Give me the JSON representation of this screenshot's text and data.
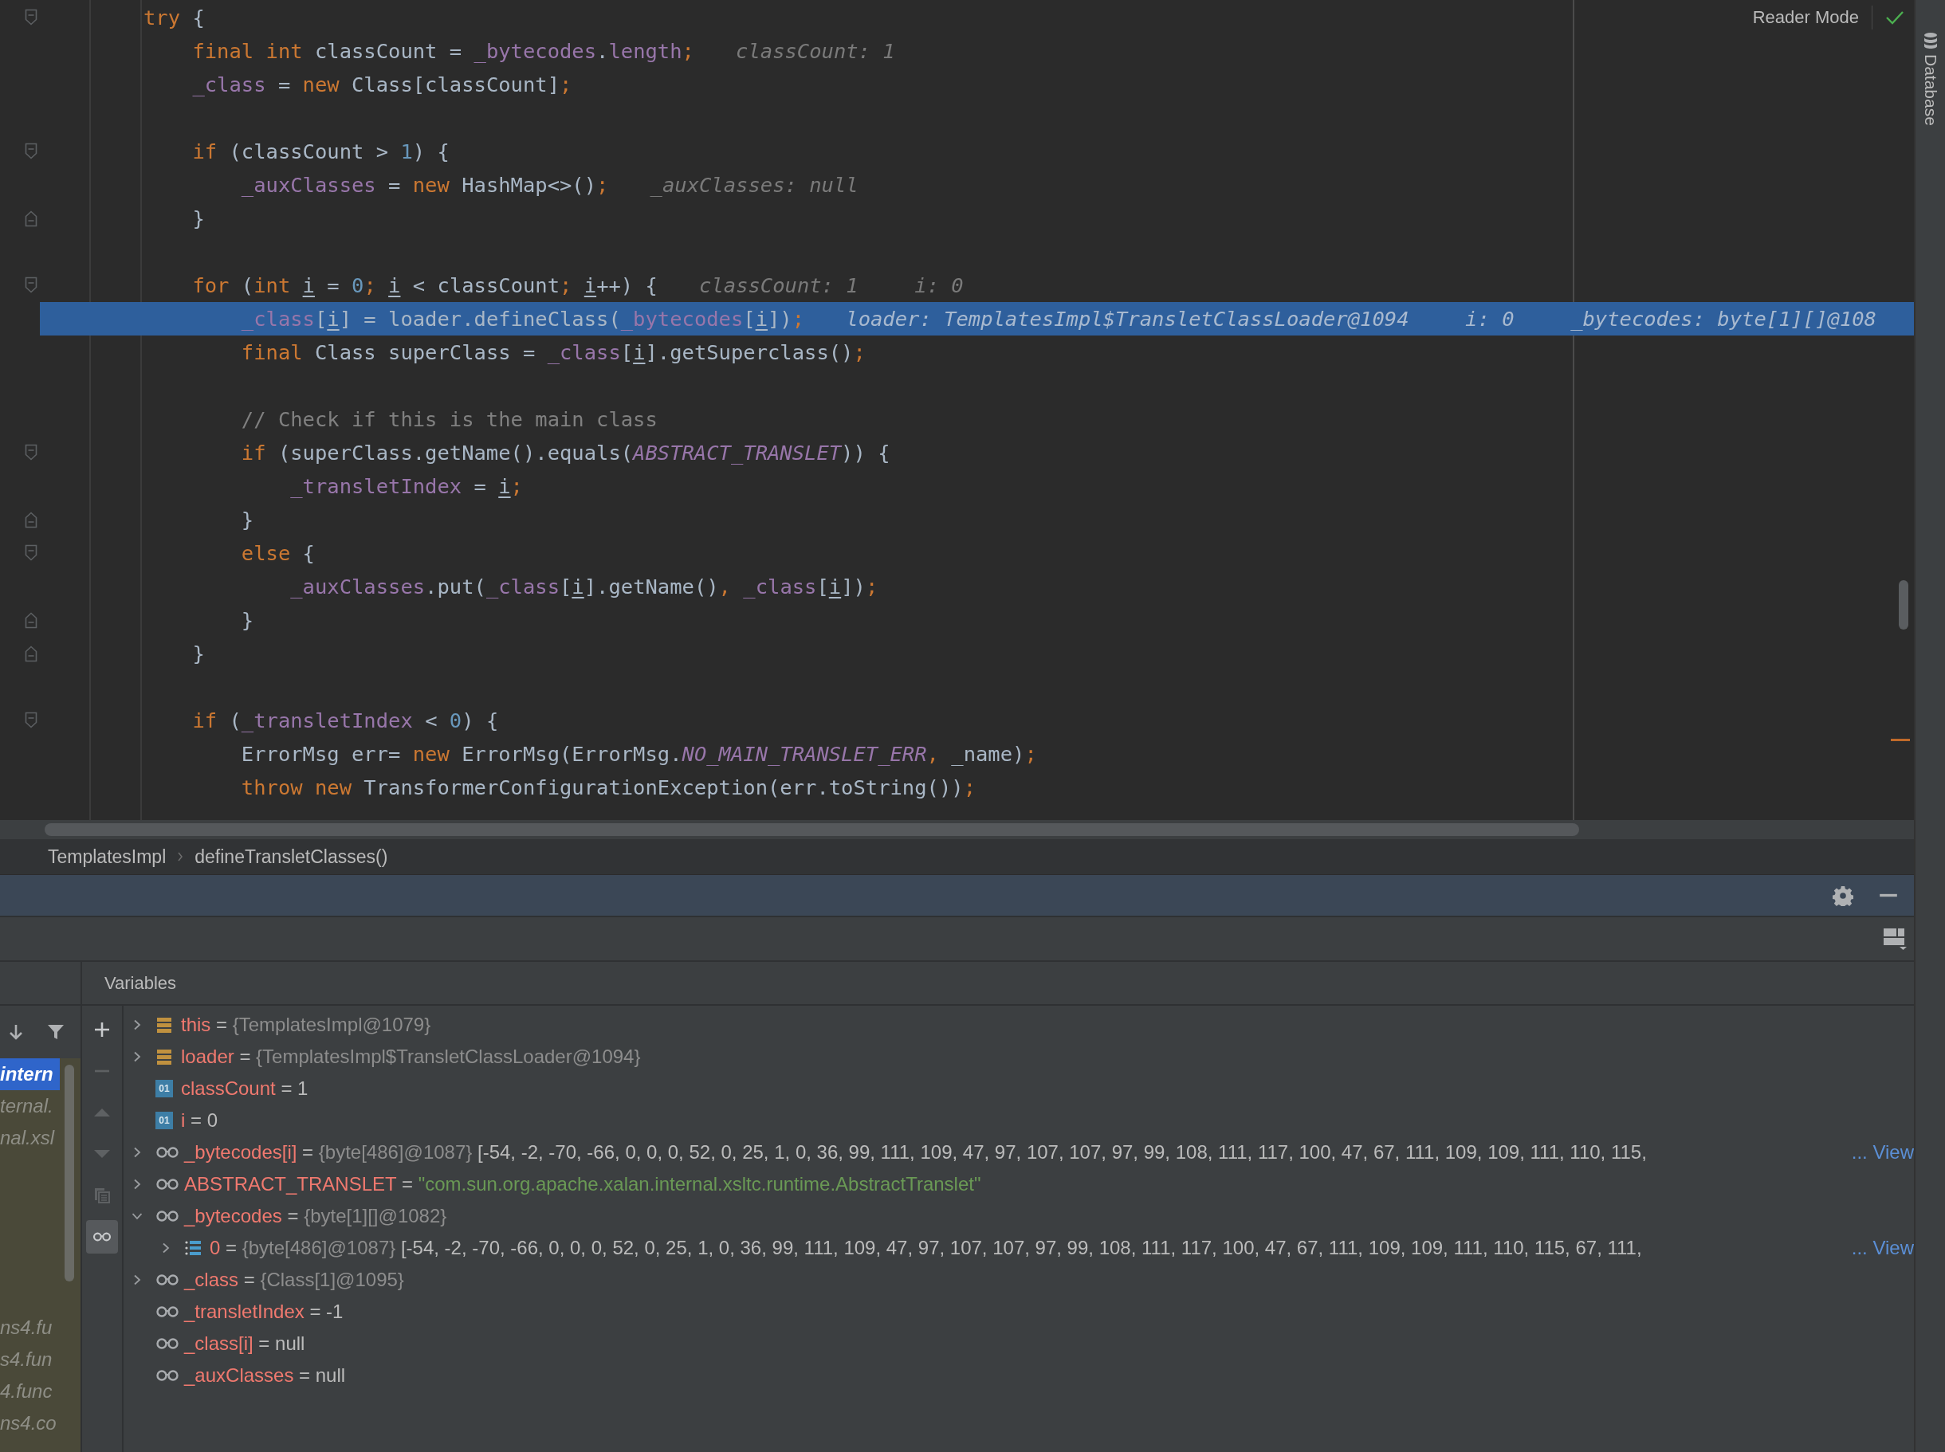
{
  "editor": {
    "reader_mode": "Reader Mode",
    "lines": [
      {
        "kind": "fold-start",
        "current": false,
        "tokens": [
          {
            "kind": "keyword",
            "text": "try"
          },
          {
            "kind": "plain",
            "text": " {"
          }
        ]
      },
      {
        "kind": "code",
        "current": false,
        "tokens": [
          {
            "kind": "keyword",
            "text": "    final int"
          },
          {
            "kind": "plain",
            "text": " classCount = "
          },
          {
            "kind": "field",
            "text": "_bytecodes"
          },
          {
            "kind": "plain",
            "text": "."
          },
          {
            "kind": "field",
            "text": "length"
          },
          {
            "kind": "punct",
            "text": ";"
          }
        ],
        "hints": [
          "classCount: 1"
        ]
      },
      {
        "kind": "code",
        "current": false,
        "tokens": [
          {
            "kind": "field",
            "text": "    _class"
          },
          {
            "kind": "plain",
            "text": " = "
          },
          {
            "kind": "keyword",
            "text": "new"
          },
          {
            "kind": "plain",
            "text": " Class[classCount]"
          },
          {
            "kind": "punct",
            "text": ";"
          }
        ]
      },
      {
        "kind": "blank",
        "current": false
      },
      {
        "kind": "fold-start",
        "current": false,
        "tokens": [
          {
            "kind": "keyword",
            "text": "    if"
          },
          {
            "kind": "plain",
            "text": " (classCount > "
          },
          {
            "kind": "number",
            "text": "1"
          },
          {
            "kind": "plain",
            "text": ") {"
          }
        ]
      },
      {
        "kind": "code",
        "current": false,
        "tokens": [
          {
            "kind": "field",
            "text": "        _auxClasses"
          },
          {
            "kind": "plain",
            "text": " = "
          },
          {
            "kind": "keyword",
            "text": "new"
          },
          {
            "kind": "plain",
            "text": " HashMap<>()"
          },
          {
            "kind": "punct",
            "text": ";"
          }
        ],
        "hints": [
          "_auxClasses: null"
        ]
      },
      {
        "kind": "fold-end",
        "current": false,
        "tokens": [
          {
            "kind": "plain",
            "text": "    }"
          }
        ]
      },
      {
        "kind": "blank",
        "current": false
      },
      {
        "kind": "fold-start",
        "current": false,
        "tokens": [
          {
            "kind": "keyword",
            "text": "    for"
          },
          {
            "kind": "plain",
            "text": " ("
          },
          {
            "kind": "keyword",
            "text": "int "
          },
          {
            "kind": "local",
            "text": "i"
          },
          {
            "kind": "plain",
            "text": " = "
          },
          {
            "kind": "number",
            "text": "0"
          },
          {
            "kind": "punct",
            "text": "; "
          },
          {
            "kind": "local",
            "text": "i"
          },
          {
            "kind": "plain",
            "text": " < classCount"
          },
          {
            "kind": "punct",
            "text": "; "
          },
          {
            "kind": "local",
            "text": "i"
          },
          {
            "kind": "plain",
            "text": "++) {"
          }
        ],
        "hints": [
          "classCount: 1",
          "i: 0"
        ]
      },
      {
        "kind": "code",
        "current": true,
        "tokens": [
          {
            "kind": "field",
            "text": "        _class"
          },
          {
            "kind": "plain",
            "text": "["
          },
          {
            "kind": "local",
            "text": "i"
          },
          {
            "kind": "plain",
            "text": "] = loader.defineClass("
          },
          {
            "kind": "field",
            "text": "_bytecodes"
          },
          {
            "kind": "plain",
            "text": "["
          },
          {
            "kind": "local",
            "text": "i"
          },
          {
            "kind": "plain",
            "text": "])"
          },
          {
            "kind": "punct",
            "text": ";"
          }
        ],
        "hints": [
          "loader: TemplatesImpl$TransletClassLoader@1094",
          "i: 0",
          "_bytecodes: byte[1][]@108"
        ]
      },
      {
        "kind": "code",
        "current": false,
        "tokens": [
          {
            "kind": "keyword",
            "text": "        final"
          },
          {
            "kind": "plain",
            "text": " Class superClass = "
          },
          {
            "kind": "field",
            "text": "_class"
          },
          {
            "kind": "plain",
            "text": "["
          },
          {
            "kind": "local",
            "text": "i"
          },
          {
            "kind": "plain",
            "text": "].getSuperclass()"
          },
          {
            "kind": "punct",
            "text": ";"
          }
        ]
      },
      {
        "kind": "blank",
        "current": false
      },
      {
        "kind": "code",
        "current": false,
        "tokens": [
          {
            "kind": "comment",
            "text": "        // Check if this is the main class"
          }
        ]
      },
      {
        "kind": "fold-start",
        "current": false,
        "tokens": [
          {
            "kind": "keyword",
            "text": "        if"
          },
          {
            "kind": "plain",
            "text": " (superClass.getName().equals("
          },
          {
            "kind": "constant",
            "text": "ABSTRACT_TRANSLET"
          },
          {
            "kind": "plain",
            "text": ")) {"
          }
        ]
      },
      {
        "kind": "code",
        "current": false,
        "tokens": [
          {
            "kind": "field",
            "text": "            _transletIndex"
          },
          {
            "kind": "plain",
            "text": " = "
          },
          {
            "kind": "local",
            "text": "i"
          },
          {
            "kind": "punct",
            "text": ";"
          }
        ]
      },
      {
        "kind": "fold-end",
        "current": false,
        "tokens": [
          {
            "kind": "plain",
            "text": "        }"
          }
        ]
      },
      {
        "kind": "fold-start",
        "current": false,
        "tokens": [
          {
            "kind": "keyword",
            "text": "        else"
          },
          {
            "kind": "plain",
            "text": " {"
          }
        ]
      },
      {
        "kind": "code",
        "current": false,
        "tokens": [
          {
            "kind": "field",
            "text": "            _auxClasses"
          },
          {
            "kind": "plain",
            "text": ".put("
          },
          {
            "kind": "field",
            "text": "_class"
          },
          {
            "kind": "plain",
            "text": "["
          },
          {
            "kind": "local",
            "text": "i"
          },
          {
            "kind": "plain",
            "text": "].getName()"
          },
          {
            "kind": "punct",
            "text": ", "
          },
          {
            "kind": "field",
            "text": "_class"
          },
          {
            "kind": "plain",
            "text": "["
          },
          {
            "kind": "local",
            "text": "i"
          },
          {
            "kind": "plain",
            "text": "])"
          },
          {
            "kind": "punct",
            "text": ";"
          }
        ]
      },
      {
        "kind": "fold-end",
        "current": false,
        "tokens": [
          {
            "kind": "plain",
            "text": "        }"
          }
        ]
      },
      {
        "kind": "fold-end",
        "current": false,
        "tokens": [
          {
            "kind": "plain",
            "text": "    }"
          }
        ]
      },
      {
        "kind": "blank",
        "current": false
      },
      {
        "kind": "fold-start",
        "current": false,
        "tokens": [
          {
            "kind": "keyword",
            "text": "    if"
          },
          {
            "kind": "plain",
            "text": " ("
          },
          {
            "kind": "field",
            "text": "_transletIndex"
          },
          {
            "kind": "plain",
            "text": " < "
          },
          {
            "kind": "number",
            "text": "0"
          },
          {
            "kind": "plain",
            "text": ") {"
          }
        ]
      },
      {
        "kind": "code",
        "current": false,
        "tokens": [
          {
            "kind": "plain",
            "text": "        ErrorMsg err= "
          },
          {
            "kind": "keyword",
            "text": "new"
          },
          {
            "kind": "plain",
            "text": " ErrorMsg(ErrorMsg."
          },
          {
            "kind": "constant",
            "text": "NO_MAIN_TRANSLET_ERR"
          },
          {
            "kind": "punct",
            "text": ", "
          },
          {
            "kind": "plain",
            "text": "_name)"
          },
          {
            "kind": "punct",
            "text": ";"
          }
        ]
      },
      {
        "kind": "code",
        "current": false,
        "tokens": [
          {
            "kind": "keyword",
            "text": "        throw new"
          },
          {
            "kind": "plain",
            "text": " TransformerConfigurationException(err.toString())"
          },
          {
            "kind": "punct",
            "text": ";"
          }
        ]
      }
    ]
  },
  "right_stripe": {
    "label": "Database"
  },
  "breadcrumbs": [
    "TemplatesImpl",
    "defineTransletClasses()"
  ],
  "debug": {
    "variables_title": "Variables",
    "frames_upper": [
      {
        "text": "intern",
        "selected": true
      },
      {
        "text": "ternal.",
        "selected": false
      },
      {
        "text": "nal.xsl",
        "selected": false
      }
    ],
    "frames_lower": [
      {
        "text": "ns4.fu",
        "selected": false
      },
      {
        "text": "s4.fun",
        "selected": false
      },
      {
        "text": "4.func",
        "selected": false
      },
      {
        "text": "ns4.co",
        "selected": false
      }
    ],
    "actions": [
      {
        "kind": "add",
        "disabled": false,
        "on": false
      },
      {
        "kind": "remove",
        "disabled": true,
        "on": false
      },
      {
        "kind": "up",
        "disabled": true,
        "on": false
      },
      {
        "kind": "down",
        "disabled": true,
        "on": false
      },
      {
        "kind": "copy",
        "disabled": true,
        "on": false
      },
      {
        "kind": "watches",
        "disabled": false,
        "on": true
      }
    ],
    "variables": [
      {
        "kind": "field",
        "expanded": false,
        "tokens": [
          {
            "kind": "name",
            "text": "this"
          },
          {
            "kind": "plain",
            "text": " = "
          },
          {
            "kind": "ref",
            "text": "{TemplatesImpl@1079}"
          }
        ]
      },
      {
        "kind": "field",
        "expanded": false,
        "tokens": [
          {
            "kind": "name",
            "text": "loader"
          },
          {
            "kind": "plain",
            "text": " = "
          },
          {
            "kind": "ref",
            "text": "{TemplatesImpl$TransletClassLoader@1094}"
          }
        ]
      },
      {
        "kind": "primitive",
        "badge": "01",
        "tokens": [
          {
            "kind": "name",
            "text": "classCount"
          },
          {
            "kind": "plain",
            "text": " = 1"
          }
        ]
      },
      {
        "kind": "primitive",
        "badge": "01",
        "tokens": [
          {
            "kind": "name",
            "text": "i"
          },
          {
            "kind": "plain",
            "text": " = 0"
          }
        ]
      },
      {
        "kind": "watch",
        "expanded": false,
        "tokens": [
          {
            "kind": "name",
            "text": "_bytecodes[i]"
          },
          {
            "kind": "plain",
            "text": " = "
          },
          {
            "kind": "ref",
            "text": "{byte[486]@1087}"
          },
          {
            "kind": "plain",
            "text": " [-54, -2, -70, -66, 0, 0, 0, 52, 0, 25, 1, 0, 36, 99, 111, 109, 47, 97, 107, 107, 97, 99, 108, 111, 117, 100, 47, 67, 111, 109, 109, 111, 110, 115,"
          }
        ],
        "link": "... View"
      },
      {
        "kind": "watch",
        "expanded": false,
        "tokens": [
          {
            "kind": "name",
            "text": "ABSTRACT_TRANSLET"
          },
          {
            "kind": "plain",
            "text": " = "
          },
          {
            "kind": "string",
            "text": "\"com.sun.org.apache.xalan.internal.xsltc.runtime.AbstractTranslet\""
          }
        ]
      },
      {
        "kind": "watch",
        "expanded": true,
        "tokens": [
          {
            "kind": "name",
            "text": "_bytecodes"
          },
          {
            "kind": "plain",
            "text": " = "
          },
          {
            "kind": "ref",
            "text": "{byte[1][]@1082}"
          }
        ],
        "children": [
          {
            "kind": "array",
            "expanded": false,
            "tokens": [
              {
                "kind": "name",
                "text": "0"
              },
              {
                "kind": "plain",
                "text": " = "
              },
              {
                "kind": "ref",
                "text": "{byte[486]@1087}"
              },
              {
                "kind": "plain",
                "text": " [-54, -2, -70, -66, 0, 0, 0, 52, 0, 25, 1, 0, 36, 99, 111, 109, 47, 97, 107, 107, 97, 99, 108, 111, 117, 100, 47, 67, 111, 109, 109, 111, 110, 115, 67, 111,"
              }
            ],
            "link": "... View"
          }
        ]
      },
      {
        "kind": "watch",
        "expanded": false,
        "tokens": [
          {
            "kind": "name",
            "text": "_class"
          },
          {
            "kind": "plain",
            "text": " = "
          },
          {
            "kind": "ref",
            "text": "{Class[1]@1095}"
          }
        ]
      },
      {
        "kind": "watch",
        "tokens": [
          {
            "kind": "name",
            "text": "_transletIndex"
          },
          {
            "kind": "plain",
            "text": " = -1"
          }
        ]
      },
      {
        "kind": "watch",
        "tokens": [
          {
            "kind": "name",
            "text": "_class[i]"
          },
          {
            "kind": "plain",
            "text": " = null"
          }
        ]
      },
      {
        "kind": "watch",
        "tokens": [
          {
            "kind": "name",
            "text": "_auxClasses"
          },
          {
            "kind": "plain",
            "text": " = null"
          }
        ]
      }
    ]
  }
}
